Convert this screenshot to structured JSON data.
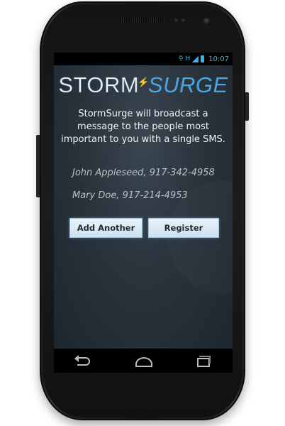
{
  "status_bar": {
    "time": "10:07",
    "network_label": "H",
    "accent_color": "#33b5e5"
  },
  "app": {
    "logo": {
      "part1": "STORM",
      "part2": "SURGE",
      "bolt_glyph": "⚡"
    },
    "intro_text": "StormSurge will broadcast a message to the people most important to you with a single SMS.",
    "contacts": [
      "John Appleseed, 917-342-4958",
      "Mary Doe, 917-214-4953"
    ],
    "buttons": {
      "add_another": "Add Another",
      "register": "Register"
    }
  },
  "nav_bar": {
    "icons": [
      "back-icon",
      "home-icon",
      "recent-apps-icon"
    ]
  },
  "colors": {
    "logo_accent": "#4aa6e3",
    "button_glow": "#50a0dc"
  }
}
